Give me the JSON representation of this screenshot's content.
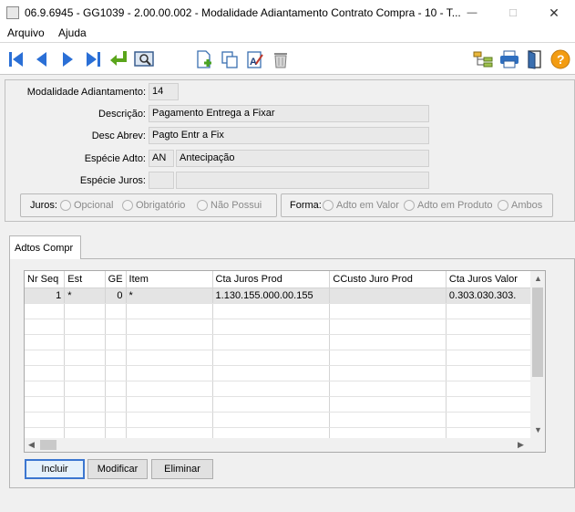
{
  "window": {
    "title": "06.9.6945 - GG1039 - 2.00.00.002 - Modalidade Adiantamento Contrato Compra - 10 - T...",
    "minimize": "—",
    "maximize": "☐",
    "close": "✕"
  },
  "menu": {
    "items": [
      "Arquivo",
      "Ajuda"
    ]
  },
  "toolbar": {
    "nav": [
      "first-record-icon",
      "previous-record-icon",
      "next-record-icon",
      "last-record-icon",
      "return-icon",
      "search-screen-icon"
    ],
    "actions": [
      "new-document-icon",
      "copy-icon",
      "edit-text-icon",
      "trash-icon"
    ],
    "utilities": [
      "structure-icon",
      "printer-icon",
      "exit-door-icon",
      "help-icon"
    ]
  },
  "form": {
    "modalidade": {
      "label": "Modalidade Adiantamento:",
      "value": "14"
    },
    "descricao": {
      "label": "Descrição:",
      "value": "Pagamento Entrega a Fixar"
    },
    "desc_abrev": {
      "label": "Desc Abrev:",
      "value": "Pagto Entr a Fix"
    },
    "especie_adto": {
      "label": "Espécie Adto:",
      "code": "AN",
      "description": "Antecipação"
    },
    "especie_juros": {
      "label": "Espécie Juros:",
      "code": "",
      "description": ""
    },
    "juros": {
      "label": "Juros:",
      "options": [
        "Opcional",
        "Obrigatório",
        "Não Possui"
      ]
    },
    "forma": {
      "label": "Forma:",
      "options": [
        "Adto em Valor",
        "Adto em Produto",
        "Ambos"
      ]
    }
  },
  "tabs": [
    {
      "label": "Adtos Compr"
    }
  ],
  "grid": {
    "columns": [
      "Nr Seq",
      "Est",
      "GE",
      "Item",
      "Cta Juros Prod",
      "CCusto Juro Prod",
      "Cta Juros Valor"
    ],
    "rows": [
      [
        "1",
        "*",
        "0",
        "*",
        "1.130.155.000.00.155",
        "",
        "0.303.030.303."
      ]
    ]
  },
  "buttons": {
    "incluir": "Incluir",
    "modificar": "Modificar",
    "eliminar": "Eliminar"
  }
}
